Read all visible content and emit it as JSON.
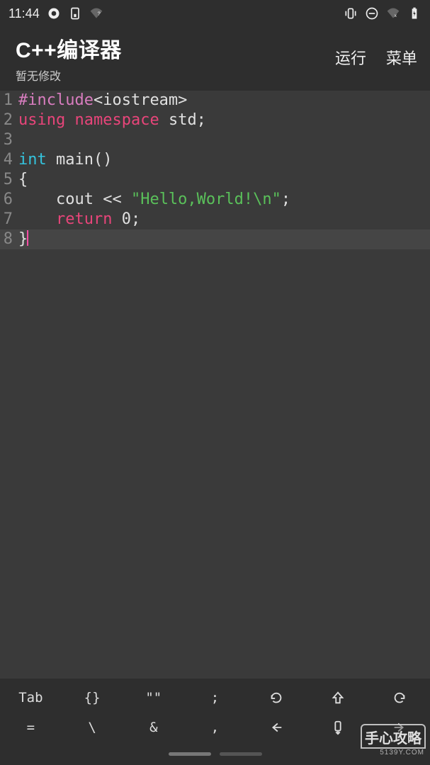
{
  "status": {
    "time": "11:44",
    "icons_left": [
      "clock-circle-icon",
      "sim-icon",
      "wifi-weak-icon"
    ],
    "icons_right": [
      "vibrate-icon",
      "dnd-icon",
      "wifi-off-icon",
      "battery-icon"
    ]
  },
  "header": {
    "title": "C++编译器",
    "subtitle": "暂无修改",
    "run_label": "运行",
    "menu_label": "菜单"
  },
  "code": {
    "lines": [
      {
        "n": "1",
        "tokens": [
          {
            "c": "tok-pre",
            "t": "#include"
          },
          {
            "c": "tok-txt",
            "t": "<iostream>"
          }
        ]
      },
      {
        "n": "2",
        "tokens": [
          {
            "c": "tok-kw",
            "t": "using"
          },
          {
            "c": "tok-txt",
            "t": " "
          },
          {
            "c": "tok-kw",
            "t": "namespace"
          },
          {
            "c": "tok-txt",
            "t": " std;"
          }
        ]
      },
      {
        "n": "3",
        "tokens": []
      },
      {
        "n": "4",
        "tokens": [
          {
            "c": "tok-type",
            "t": "int"
          },
          {
            "c": "tok-txt",
            "t": " main()"
          }
        ]
      },
      {
        "n": "5",
        "tokens": [
          {
            "c": "tok-txt",
            "t": "{"
          }
        ]
      },
      {
        "n": "6",
        "tokens": [
          {
            "c": "tok-txt",
            "t": "    cout << "
          },
          {
            "c": "tok-str",
            "t": "\"Hello,World!\\n\""
          },
          {
            "c": "tok-txt",
            "t": ";"
          }
        ]
      },
      {
        "n": "7",
        "tokens": [
          {
            "c": "tok-txt",
            "t": "    "
          },
          {
            "c": "tok-kw",
            "t": "return"
          },
          {
            "c": "tok-txt",
            "t": " 0;"
          }
        ]
      },
      {
        "n": "8",
        "tokens": [
          {
            "c": "tok-txt",
            "t": "}"
          }
        ],
        "cursor": true,
        "current": true
      }
    ]
  },
  "toolbar": {
    "row1": [
      "Tab",
      "{}",
      "\"\"",
      ";",
      "undo-icon",
      "shift-up-icon",
      "redo-icon"
    ],
    "row2": [
      "=",
      "\\",
      "&",
      ",",
      "back-icon",
      "down-icon",
      "forward-icon"
    ]
  },
  "watermark": {
    "main": "手心攻略",
    "sub": "5139Y.COM"
  }
}
